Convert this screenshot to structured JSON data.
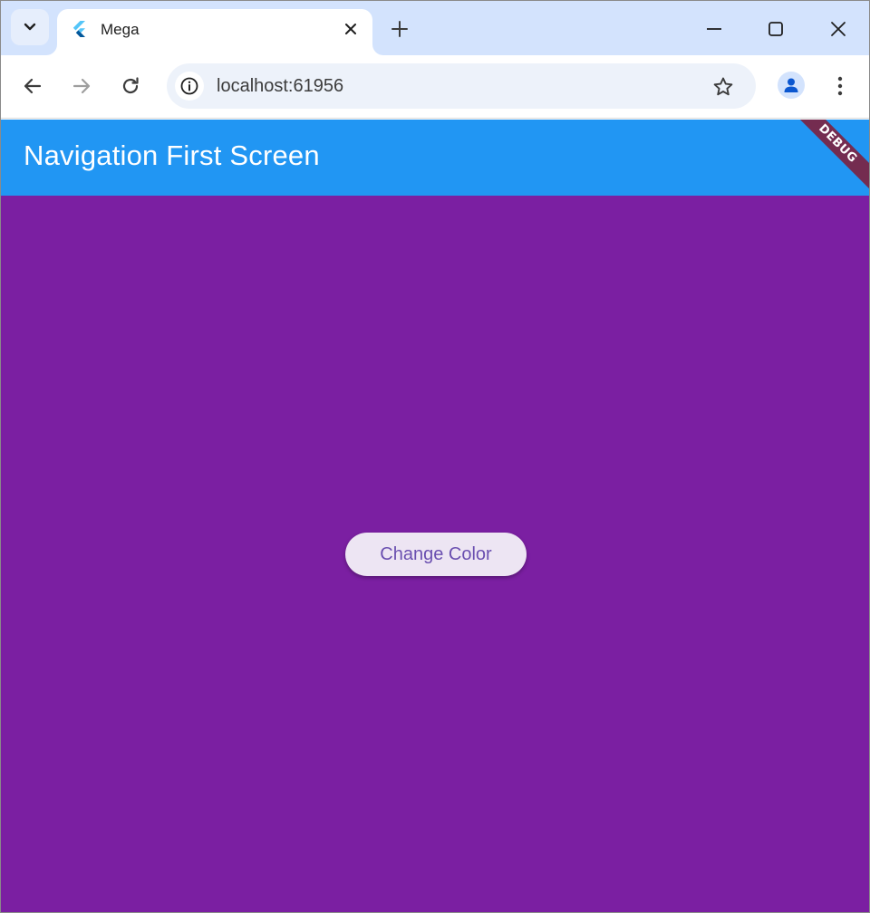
{
  "browser": {
    "tab": {
      "title": "Mega",
      "favicon": "flutter-logo-icon"
    },
    "address_bar": {
      "url": "localhost:61956"
    },
    "icons": {
      "tab_search": "chevron-down-icon",
      "close_tab": "close-icon",
      "new_tab": "plus-icon",
      "minimize": "minimize-icon",
      "maximize": "maximize-icon",
      "close_window": "close-icon",
      "back": "arrow-left-icon",
      "forward": "arrow-right-icon",
      "reload": "reload-icon",
      "site_info": "info-icon",
      "bookmark": "star-icon",
      "profile": "person-icon",
      "menu": "kebab-menu-icon"
    }
  },
  "app": {
    "appbar": {
      "title": "Navigation First Screen"
    },
    "debug_banner": "DEBUG",
    "button": {
      "label": "Change Color"
    },
    "colors": {
      "appbar": "#2196f3",
      "background": "#7b1fa2",
      "button_bg": "#ede5f3",
      "button_text": "#6a4fb0",
      "debug_banner": "#7d203e"
    }
  }
}
